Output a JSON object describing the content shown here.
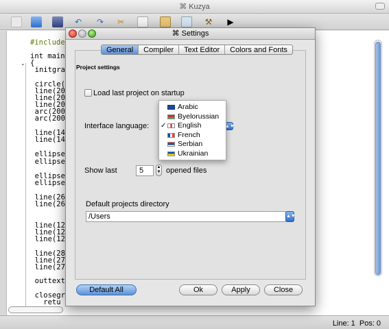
{
  "main_window": {
    "title": "Kuzya",
    "status": {
      "line_label": "Line:",
      "line_value": "1",
      "pos_label": "Pos:",
      "pos_value": "0"
    }
  },
  "toolbar": {
    "icons": [
      "new-file-icon",
      "open-file-icon",
      "save-icon",
      "undo-icon",
      "redo-icon",
      "cut-icon",
      "copy-icon",
      "paste-icon",
      "compile-icon",
      "settings-icon",
      "run-icon"
    ]
  },
  "editor": {
    "lines": [
      "#include",
      "int main",
      "{",
      "  initgra",
      "  circle(",
      "  line(20",
      "  line(20",
      "  line(20",
      "  arc(200",
      "  arc(200",
      "  line(14",
      "  line(14",
      "  ellipse",
      "  ellipse",
      "  ellipse",
      "  ellipse",
      "  line(26",
      "  line(26",
      "  line(12",
      "  line(12",
      "  line(12",
      "  line(28",
      "  line(27",
      "  line(27",
      "  outtext",
      "  closegr",
      "    retu"
    ]
  },
  "dialog": {
    "title": "Settings",
    "tabs": [
      "General",
      "Compiler",
      "Text Editor",
      "Colors and Fonts"
    ],
    "section_title": "Project settings",
    "load_last_label": "Load last project on startup",
    "interface_language_label": "Interface language:",
    "languages": [
      "Arabic",
      "Byelorussian",
      "English",
      "French",
      "Serbian",
      "Ukrainian"
    ],
    "selected_language": "English",
    "show_last_label": "Show last",
    "show_last_value": "5",
    "opened_files_label": "opened files",
    "default_dir_label": "Default projects directory",
    "default_dir_value": "/Users",
    "buttons": {
      "default_all": "Default All",
      "ok": "Ok",
      "apply": "Apply",
      "close": "Close"
    }
  }
}
